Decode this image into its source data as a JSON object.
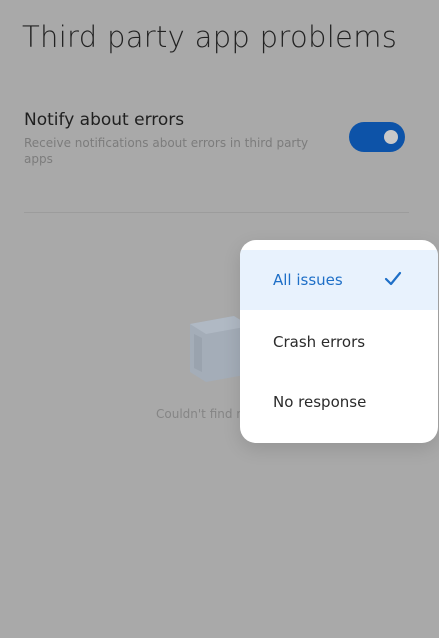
{
  "page": {
    "title": "Third party app problems"
  },
  "notify_setting": {
    "title": "Notify about errors",
    "description": "Receive notifications about errors in third party apps",
    "toggle_on": true,
    "toggle_color": "#0d53a8"
  },
  "empty_state": {
    "icon": "empty-box-icon",
    "message": "Couldn't find r"
  },
  "dropdown": {
    "options": [
      {
        "label": "All issues",
        "selected": true
      },
      {
        "label": "Crash errors",
        "selected": false
      },
      {
        "label": "No response",
        "selected": false
      }
    ],
    "selected_icon": "checkmark-icon",
    "accent_color": "#1e6fc7"
  },
  "colors": {
    "scrim_background": "#a9a9a9",
    "selected_option_bg": "#e8f2fd"
  }
}
